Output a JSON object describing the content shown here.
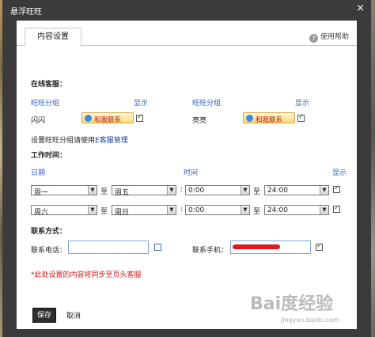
{
  "window": {
    "title": "悬浮旺旺",
    "close_label": "×"
  },
  "tab": {
    "label": "内容设置"
  },
  "help": {
    "label": "使用帮助",
    "icon_glyph": "?"
  },
  "online_service": {
    "heading": "在线客服：",
    "col_group": "旺旺分组",
    "col_show": "显示",
    "entries": [
      {
        "name": "闪闪",
        "button_label": "和我联系",
        "shown": true
      },
      {
        "name": "亮亮",
        "button_label": "和我联系",
        "shown": true
      }
    ],
    "note_prefix": "设置旺旺分组请使用",
    "note_link": "E客服管理"
  },
  "work_time": {
    "heading": "工作时间：",
    "col_date": "日期",
    "col_time": "时间",
    "col_show": "显示",
    "sep_to": "至",
    "sep_colon": ":",
    "rows": [
      {
        "from_day": "周一",
        "to_day": "周五",
        "from_time": "0:00",
        "to_time": "24:00",
        "shown": true
      },
      {
        "from_day": "周六",
        "to_day": "周日",
        "from_time": "0:00",
        "to_time": "24:00",
        "shown": true
      }
    ]
  },
  "contact": {
    "heading": "联系方式：",
    "phone_label": "联系电话：",
    "phone_value": "",
    "phone_shown": false,
    "mobile_label": "联系手机：",
    "mobile_shown": true,
    "sync_note": "*此处设置的内容将同步至页头客服"
  },
  "actions": {
    "save": "保存",
    "cancel": "取消"
  },
  "watermark": {
    "logo": "Bai度经验",
    "url": "jingyan.baidu.com"
  },
  "colors": {
    "titlebar": "#3b3b3b",
    "link": "#2f5fc2",
    "note_red": "#d21414",
    "check": "#1a7a1a"
  }
}
